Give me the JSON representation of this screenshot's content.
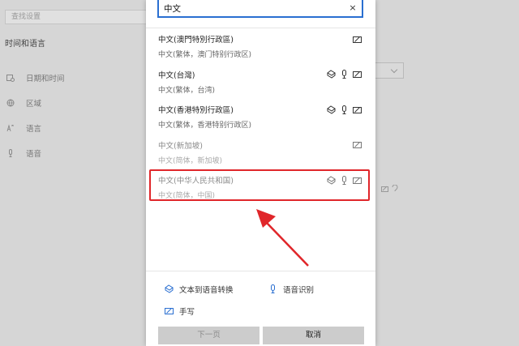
{
  "background": {
    "search_placeholder": "查找设置",
    "section_title": "时间和语言",
    "nav": [
      {
        "label": "日期和时间",
        "icon": "calendar-clock-icon"
      },
      {
        "label": "区域",
        "icon": "globe-icon"
      },
      {
        "label": "语言",
        "icon": "language-icon"
      },
      {
        "label": "语音",
        "icon": "microphone-icon"
      }
    ]
  },
  "dialog": {
    "search_value": "中文",
    "clear_label": "×",
    "languages": [
      {
        "name": "中文(澳門特別行政區)",
        "sub": "中文(繁体，澳门特别行政区)",
        "features": [
          "handwriting"
        ],
        "dim": false
      },
      {
        "name": "中文(台灣)",
        "sub": "中文(繁体，台湾)",
        "features": [
          "tts",
          "speech",
          "handwriting"
        ],
        "dim": false
      },
      {
        "name": "中文(香港特別行政區)",
        "sub": "中文(繁体，香港特别行政区)",
        "features": [
          "tts",
          "speech",
          "handwriting"
        ],
        "dim": false
      },
      {
        "name": "中文(新加坡)",
        "sub": "中文(简体，新加坡)",
        "features": [
          "handwriting"
        ],
        "dim": true
      },
      {
        "name": "中文(中华人民共和国)",
        "sub": "中文(简体，中国)",
        "features": [
          "tts",
          "speech",
          "handwriting"
        ],
        "dim": true
      }
    ],
    "legend": {
      "tts": "文本到语音转换",
      "speech": "语音识别",
      "handwriting": "手写"
    },
    "buttons": {
      "next": "下一页",
      "cancel": "取消"
    }
  },
  "colors": {
    "accent": "#2a6fd1",
    "highlight": "#e0262a",
    "arrow": "#e0262a"
  }
}
